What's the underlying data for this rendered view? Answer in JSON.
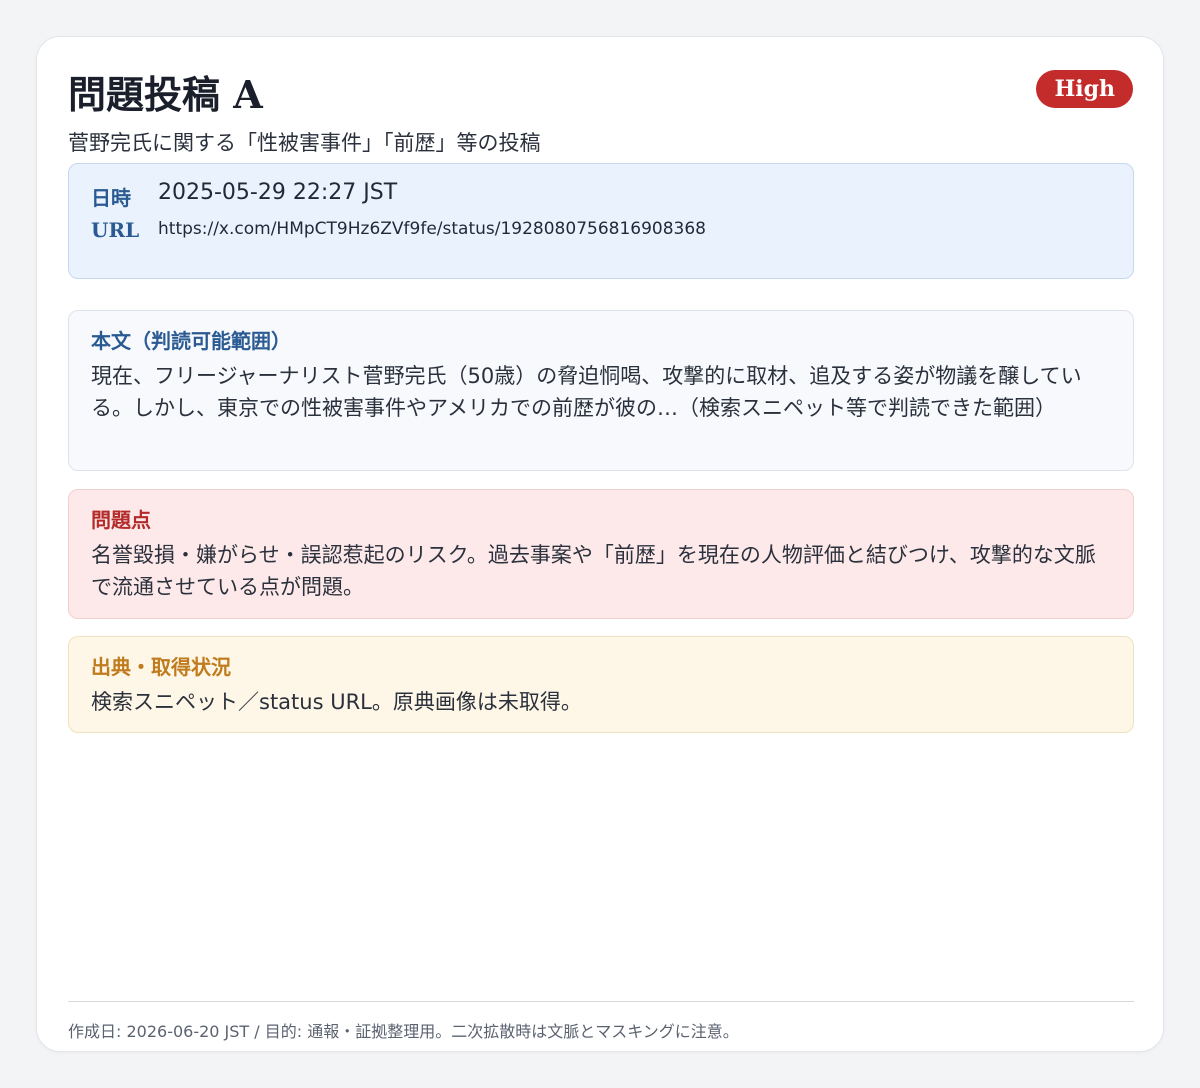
{
  "header": {
    "title": "問題投稿 A",
    "subtitle": "菅野完氏に関する「性被害事件」「前歴」等の投稿",
    "severity_badge": "High"
  },
  "meta": {
    "date_label": "日時",
    "date_value": "2025-05-29 22:27 JST",
    "url_label": "URL",
    "url_value": "https://x.com/HMpCT9Hz6ZVf9fe/status/1928080756816908368"
  },
  "sections": {
    "body": {
      "title": "本文（判読可能範囲）",
      "text": "現在、フリージャーナリスト菅野完氏（50歳）の脅迫恫喝、攻撃的に取材、追及する姿が物議を醸している。しかし、東京での性被害事件やアメリカでの前歴が彼の…（検索スニペット等で判読できた範囲）"
    },
    "issue": {
      "title": "問題点",
      "text": "名誉毀損・嫌がらせ・誤認惹起のリスク。過去事案や「前歴」を現在の人物評価と結びつけ、攻撃的な文脈で流通させている点が問題。"
    },
    "source": {
      "title": "出典・取得状況",
      "text": "検索スニペット／status URL。原典画像は未取得。"
    }
  },
  "footer": {
    "text": "作成日: 2026-06-20 JST / 目的: 通報・証拠整理用。二次拡散時は文脈とマスキングに注意。"
  },
  "colors": {
    "badge": "#c42b2b",
    "meta_bg": "#eaf2fe",
    "body_bg": "#f7f9fd",
    "issue_bg": "#fde9e9",
    "source_bg": "#fef6e6",
    "accent_blue": "#2a5a92",
    "accent_red": "#b42a2a",
    "accent_orange": "#c07b1c"
  }
}
